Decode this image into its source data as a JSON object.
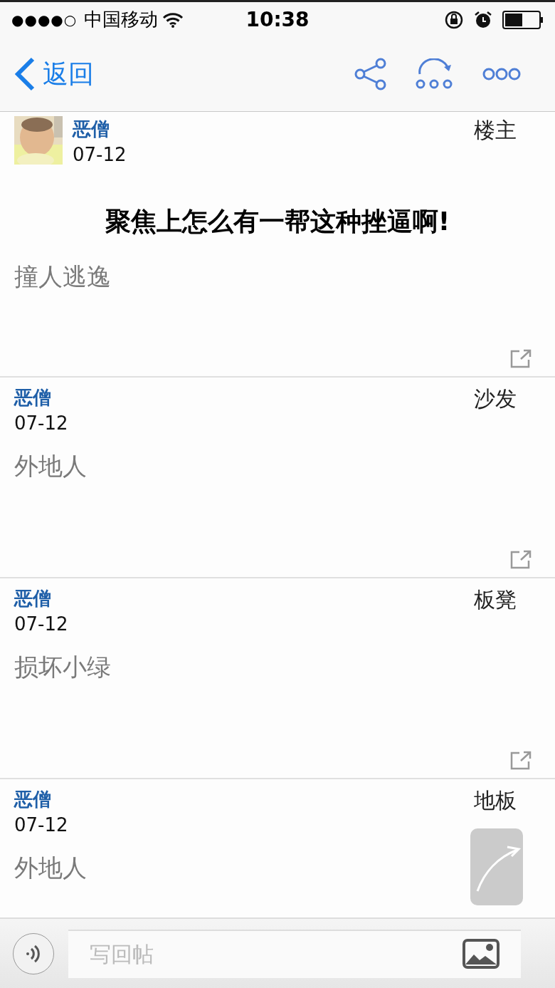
{
  "status_bar": {
    "signal": "●●●●○",
    "carrier": "中国移动",
    "time": "10:38"
  },
  "nav": {
    "back": "返回"
  },
  "posts": [
    {
      "author": "恶僧",
      "date": "07-12",
      "floor": "楼主",
      "title": "聚焦上怎么有一帮这种挫逼啊!",
      "content": "撞人逃逸"
    },
    {
      "author": "恶僧",
      "date": "07-12",
      "floor": "沙发",
      "content": "外地人"
    },
    {
      "author": "恶僧",
      "date": "07-12",
      "floor": "板凳",
      "content": "损坏小绿"
    },
    {
      "author": "恶僧",
      "date": "07-12",
      "floor": "地板",
      "content": "外地人"
    }
  ],
  "reply": {
    "placeholder": "写回帖"
  }
}
